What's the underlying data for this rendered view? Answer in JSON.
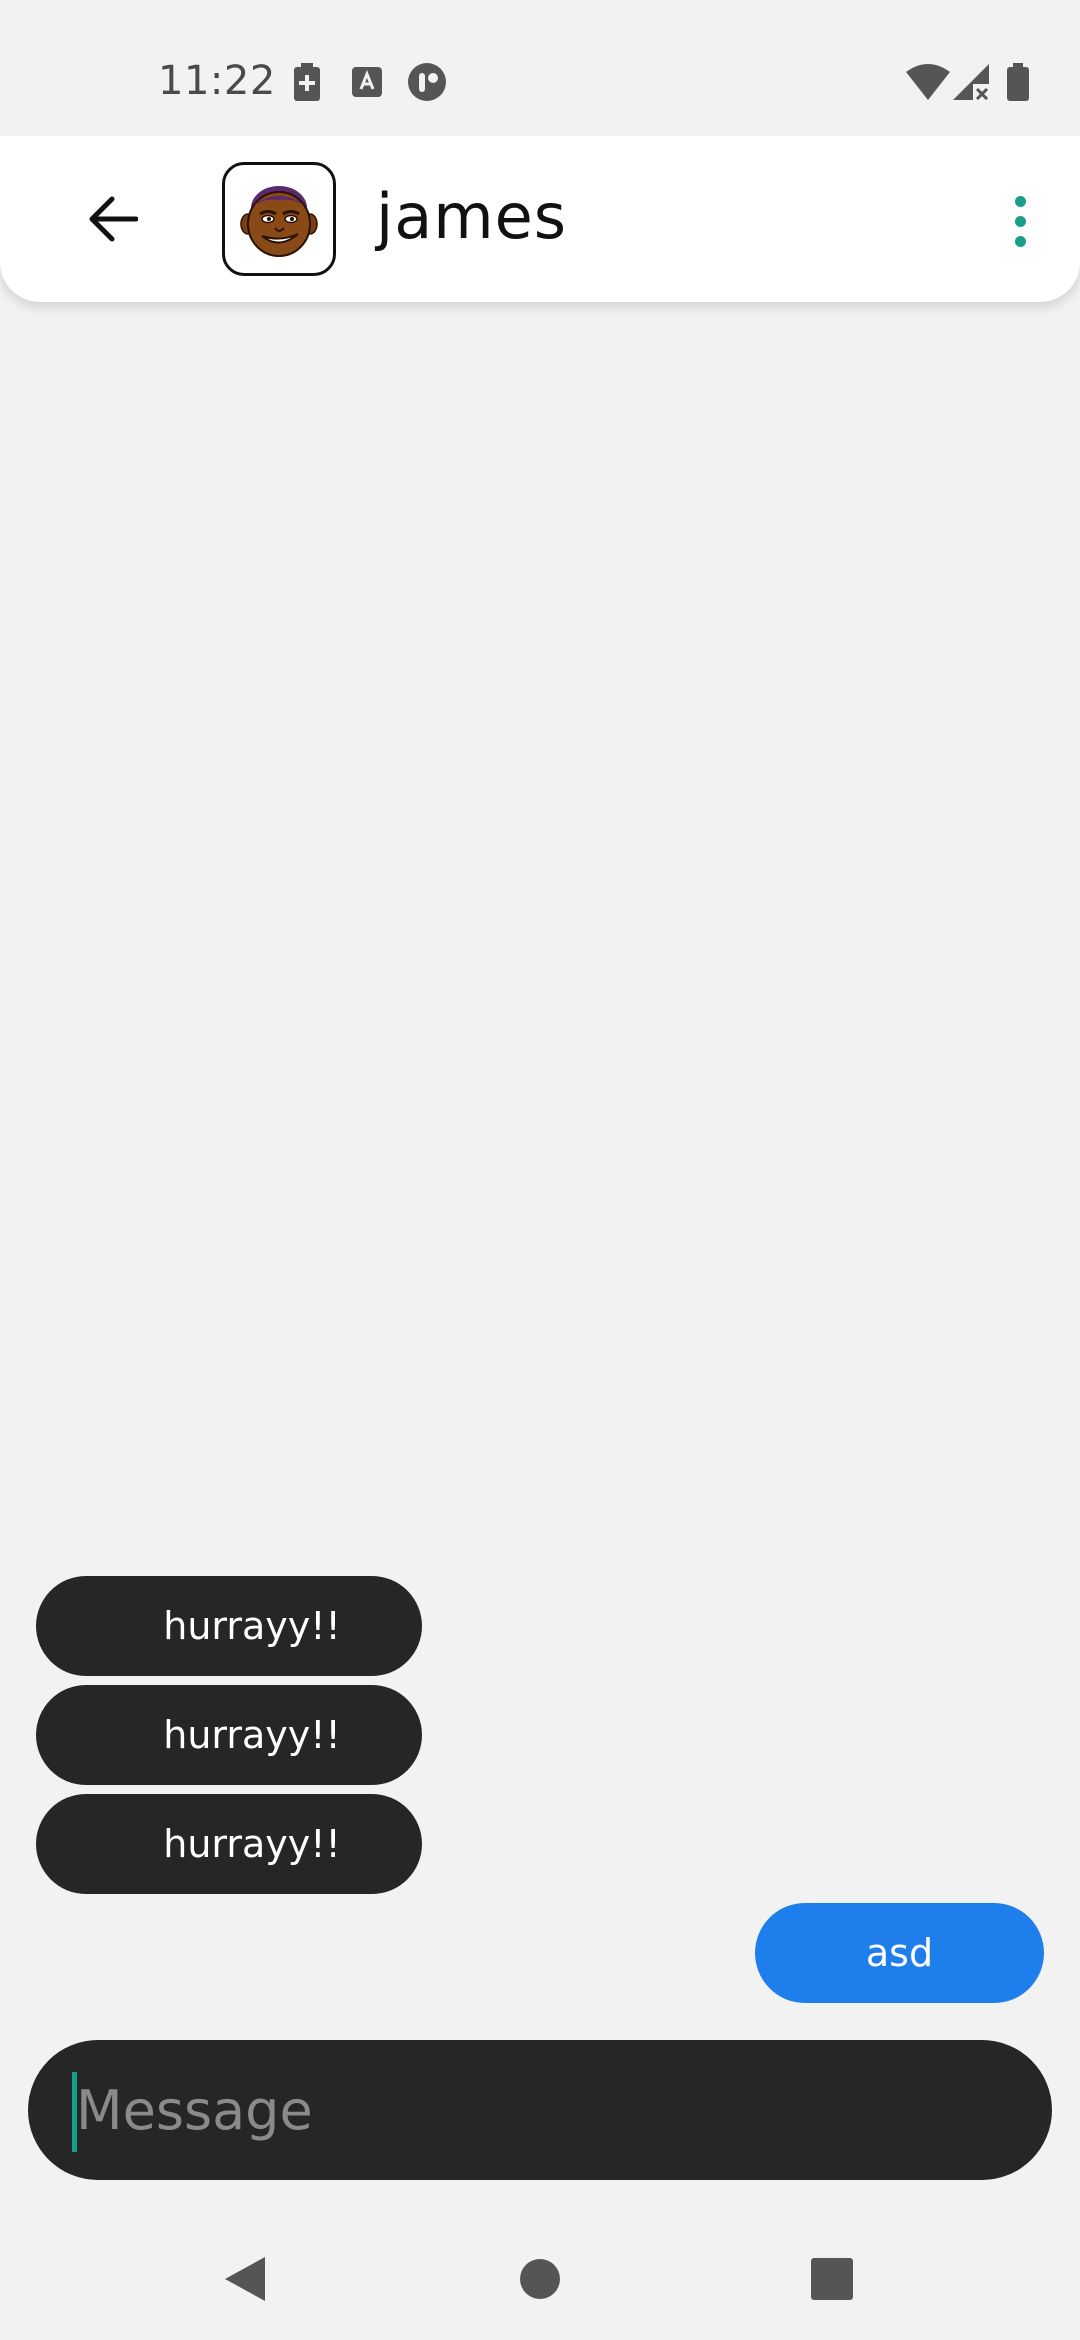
{
  "status_bar": {
    "time": "11:22",
    "icons": [
      "battery-saver-icon",
      "text-a-icon",
      "app-notification-icon",
      "wifi-icon",
      "signal-off-icon",
      "battery-icon"
    ]
  },
  "header": {
    "contact_name": "james",
    "back_icon": "arrow-back-icon",
    "menu_icon": "more-vert-icon",
    "accent_color": "#1a9e8a"
  },
  "messages": [
    {
      "direction": "received",
      "text": "hurrayy!!"
    },
    {
      "direction": "received",
      "text": "hurrayy!!"
    },
    {
      "direction": "received",
      "text": "hurrayy!!"
    },
    {
      "direction": "sent",
      "text": "asd"
    }
  ],
  "composer": {
    "placeholder": "Message",
    "value": ""
  },
  "colors": {
    "received_bubble": "#262626",
    "sent_bubble": "#1e7fec",
    "background": "#f2f2f2"
  },
  "nav_bar": {
    "icons": [
      "nav-back-icon",
      "nav-home-icon",
      "nav-recents-icon"
    ]
  }
}
